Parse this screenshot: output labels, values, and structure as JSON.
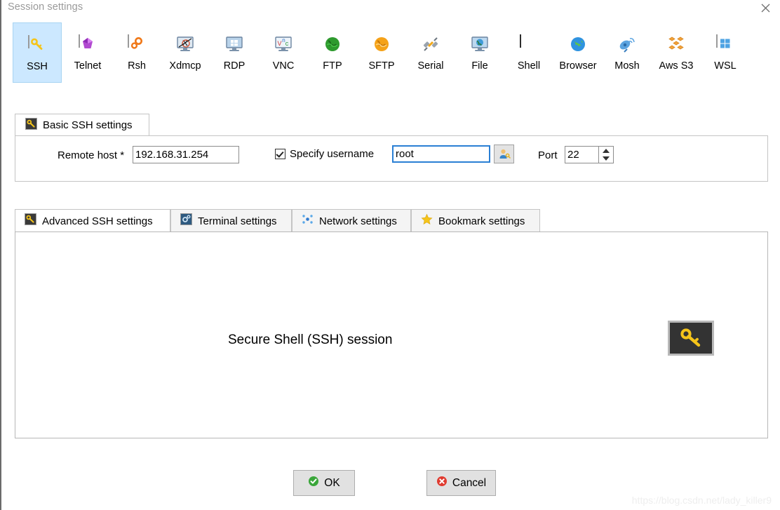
{
  "window": {
    "title": "Session settings",
    "close_icon": "close-icon"
  },
  "session_types": [
    {
      "label": "SSH",
      "icon": "key-icon",
      "selected": true
    },
    {
      "label": "Telnet",
      "icon": "purple-gem-icon",
      "selected": false
    },
    {
      "label": "Rsh",
      "icon": "orange-gears-icon",
      "selected": false
    },
    {
      "label": "Xdmcp",
      "icon": "x-monitor-icon",
      "selected": false
    },
    {
      "label": "RDP",
      "icon": "windows-monitor-icon",
      "selected": false
    },
    {
      "label": "VNC",
      "icon": "vnc-monitor-icon",
      "selected": false
    },
    {
      "label": "FTP",
      "icon": "green-globe-icon",
      "selected": false
    },
    {
      "label": "SFTP",
      "icon": "orange-globe-icon",
      "selected": false
    },
    {
      "label": "Serial",
      "icon": "serial-plug-icon",
      "selected": false
    },
    {
      "label": "File",
      "icon": "file-monitor-icon",
      "selected": false
    },
    {
      "label": "Shell",
      "icon": "shell-prompt-icon",
      "selected": false
    },
    {
      "label": "Browser",
      "icon": "blue-globe-icon",
      "selected": false
    },
    {
      "label": "Mosh",
      "icon": "satellite-dish-icon",
      "selected": false
    },
    {
      "label": "Aws S3",
      "icon": "aws-cubes-icon",
      "selected": false
    },
    {
      "label": "WSL",
      "icon": "windows-logo-icon",
      "selected": false
    }
  ],
  "basic_settings": {
    "tab_label": "Basic SSH settings",
    "tab_icon": "key-icon",
    "remote_host_label": "Remote host *",
    "remote_host_value": "192.168.31.254",
    "specify_username_label": "Specify username",
    "specify_username_checked": true,
    "username_value": "root",
    "username_button_icon": "user-key-icon",
    "port_label": "Port",
    "port_value": "22",
    "spinner_up_icon": "chevron-up-icon",
    "spinner_down_icon": "chevron-down-icon"
  },
  "lower_tabs": [
    {
      "label": "Advanced SSH settings",
      "icon": "key-icon",
      "active": true
    },
    {
      "label": "Terminal settings",
      "icon": "terminal-gear-icon",
      "active": false
    },
    {
      "label": "Network settings",
      "icon": "network-nodes-icon",
      "active": false
    },
    {
      "label": "Bookmark settings",
      "icon": "star-icon",
      "active": false
    }
  ],
  "panel": {
    "description": "Secure Shell (SSH) session",
    "badge_icon": "key-icon"
  },
  "footer": {
    "ok_label": "OK",
    "ok_icon": "green-check-icon",
    "cancel_label": "Cancel",
    "cancel_icon": "red-x-icon"
  },
  "watermark": {
    "text": "https://blog.csdn.net/lady_killer9"
  },
  "colors": {
    "selection_blue": "#cce8ff",
    "focus_blue": "#2a7fd4",
    "key_yellow": "#f5c41a",
    "ok_green": "#3aa63a",
    "cancel_red": "#e03b30",
    "title_gray": "#9a9a9a"
  }
}
